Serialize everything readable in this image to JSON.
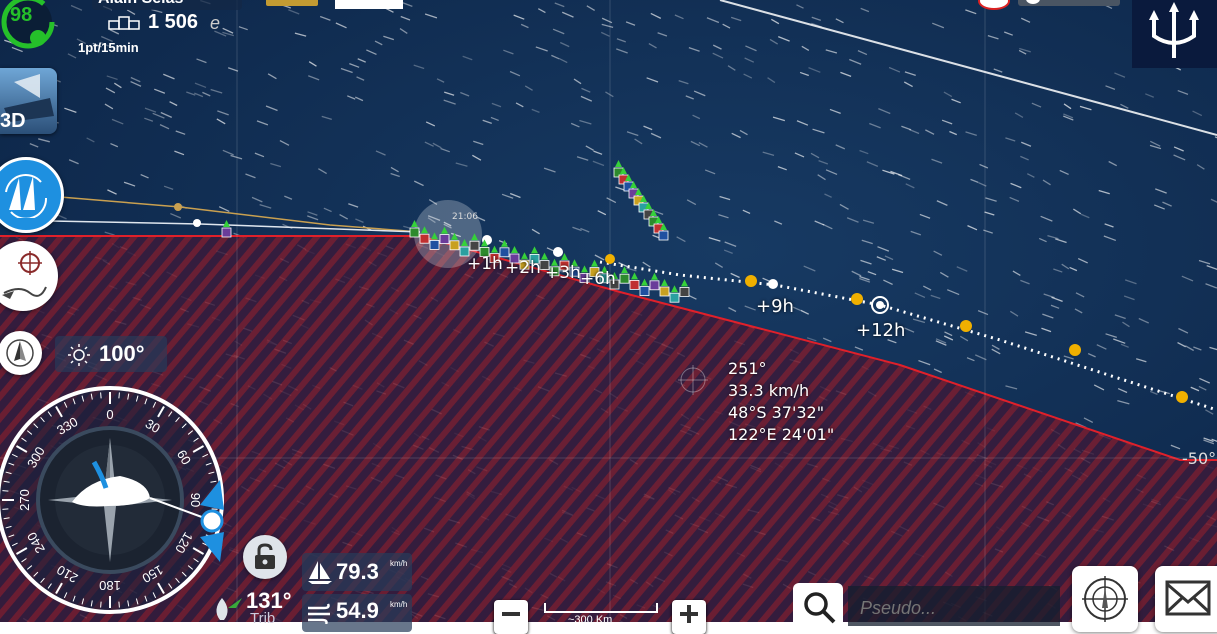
{
  "header": {
    "rank_badge": "98",
    "player_name": "Alain Selas",
    "points_value": "1 506",
    "points_unit": "e",
    "rate_label": "1pt/15min"
  },
  "left_menu": {
    "view_3d_label": "3D"
  },
  "map": {
    "route_markers": [
      "+1h",
      "+2h",
      "+3h",
      "+6h",
      "+9h",
      "+12h"
    ],
    "fleet_time_label": "21:06",
    "cursor_info": {
      "heading": "251°",
      "speed": "33.3 km/h",
      "lat": "48°S 37'32\"",
      "lon": "122°E 24'01\""
    },
    "latitude_label": "-50°",
    "scale_label": "~300 Km"
  },
  "compass": {
    "twa_value": "100°",
    "ticks": [
      "0",
      "30",
      "60",
      "90",
      "120",
      "150",
      "180",
      "210",
      "240",
      "270",
      "300",
      "330"
    ]
  },
  "stats": {
    "boat_speed_value": "79.3",
    "boat_speed_unit": "km/h",
    "wind_speed_value": "54.9",
    "wind_speed_unit": "km/h",
    "heading_value": "131°",
    "sail_label": "Trib"
  },
  "search": {
    "placeholder": "Pseudo..."
  },
  "colors": {
    "ocean": "#0e2a4f",
    "exclusion_zone": "#6b1a2a",
    "limit_line": "#e0202a",
    "accent_blue": "#1e90e0",
    "rank_green": "#25c02a"
  }
}
